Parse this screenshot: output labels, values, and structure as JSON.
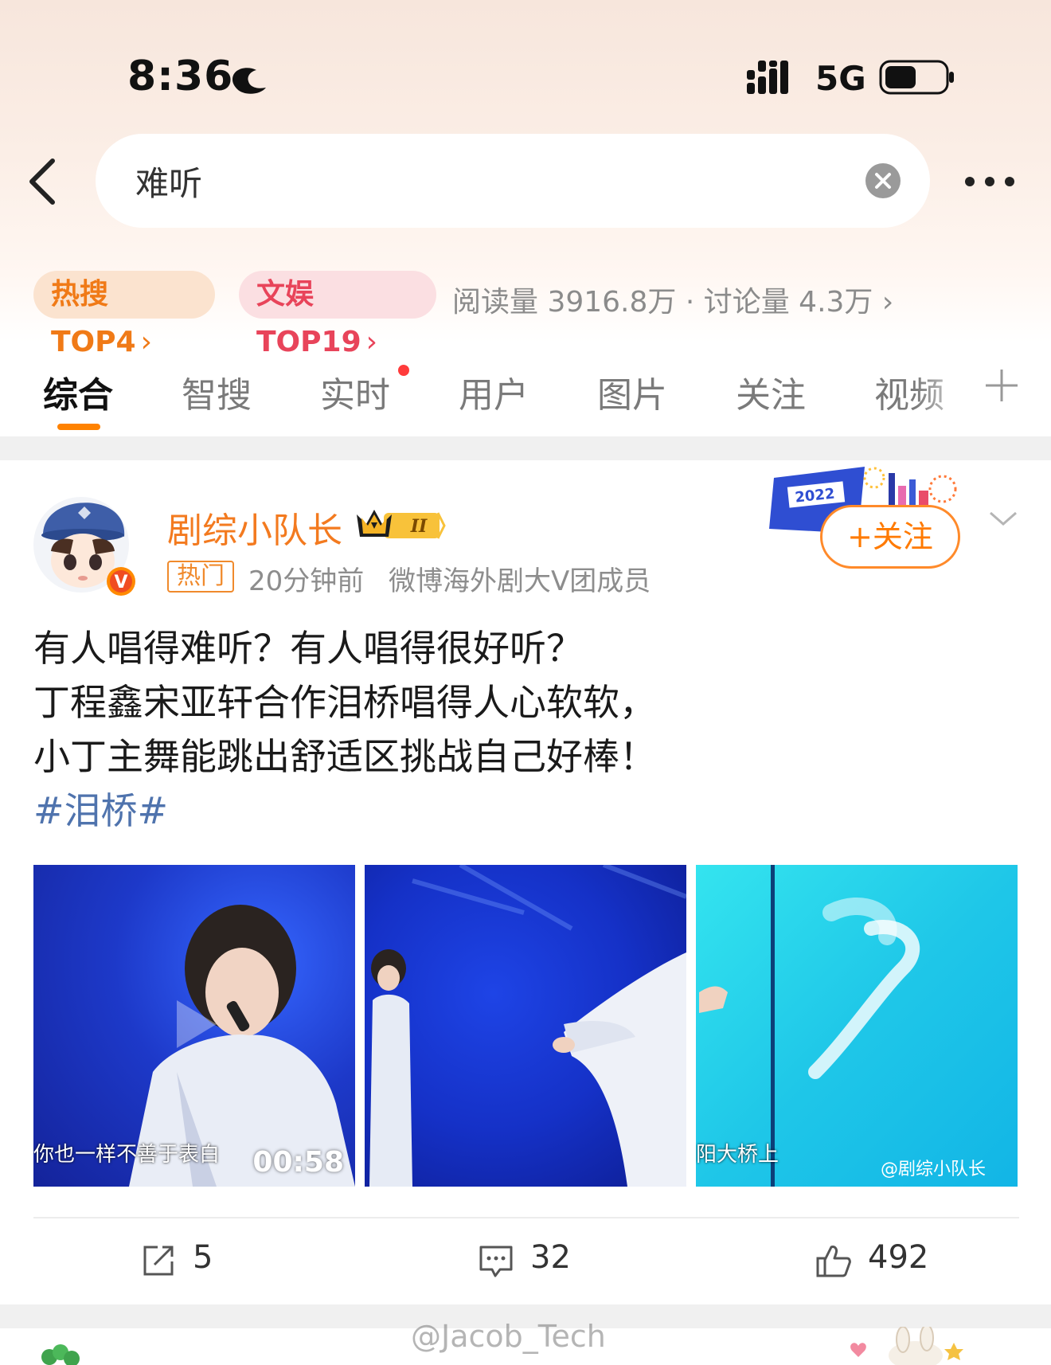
{
  "status_bar": {
    "time": "8:36",
    "network": "5G"
  },
  "search": {
    "query": "难听"
  },
  "trends": {
    "hot_search": "热搜TOP4",
    "ent_search": "文娱TOP19",
    "stats": "阅读量 3916.8万 · 讨论量 4.3万"
  },
  "tabs": [
    "综合",
    "智搜",
    "实时",
    "用户",
    "图片",
    "关注",
    "视频"
  ],
  "active_tab": 0,
  "post": {
    "author": "剧综小队长",
    "badge_level": "II",
    "hot_tag": "热门",
    "time": "20分钟前",
    "role": "微博海外剧大V团成员",
    "follow_label": "+关注",
    "banner_text": "2022",
    "lines": [
      "有人唱得难听？有人唱得很好听？",
      "丁程鑫宋亚轩合作泪桥唱得人心软软，",
      "小丁主舞能跳出舒适区挑战自己好棒！"
    ],
    "hashtag": "#泪桥#",
    "images": [
      {
        "subtitle": "你也一样不善于表白",
        "duration": "00:58"
      },
      {
        "subtitle": ""
      },
      {
        "subtitle": "阳大桥上",
        "watermark": "@剧综小队长"
      }
    ],
    "actions": {
      "reposts": "5",
      "comments": "32",
      "likes": "492"
    }
  },
  "watermark": "@Jacob_Tech",
  "colors": {
    "accent": "#ff8200",
    "hashtag": "#4f73ad",
    "author": "#f37a1f"
  }
}
